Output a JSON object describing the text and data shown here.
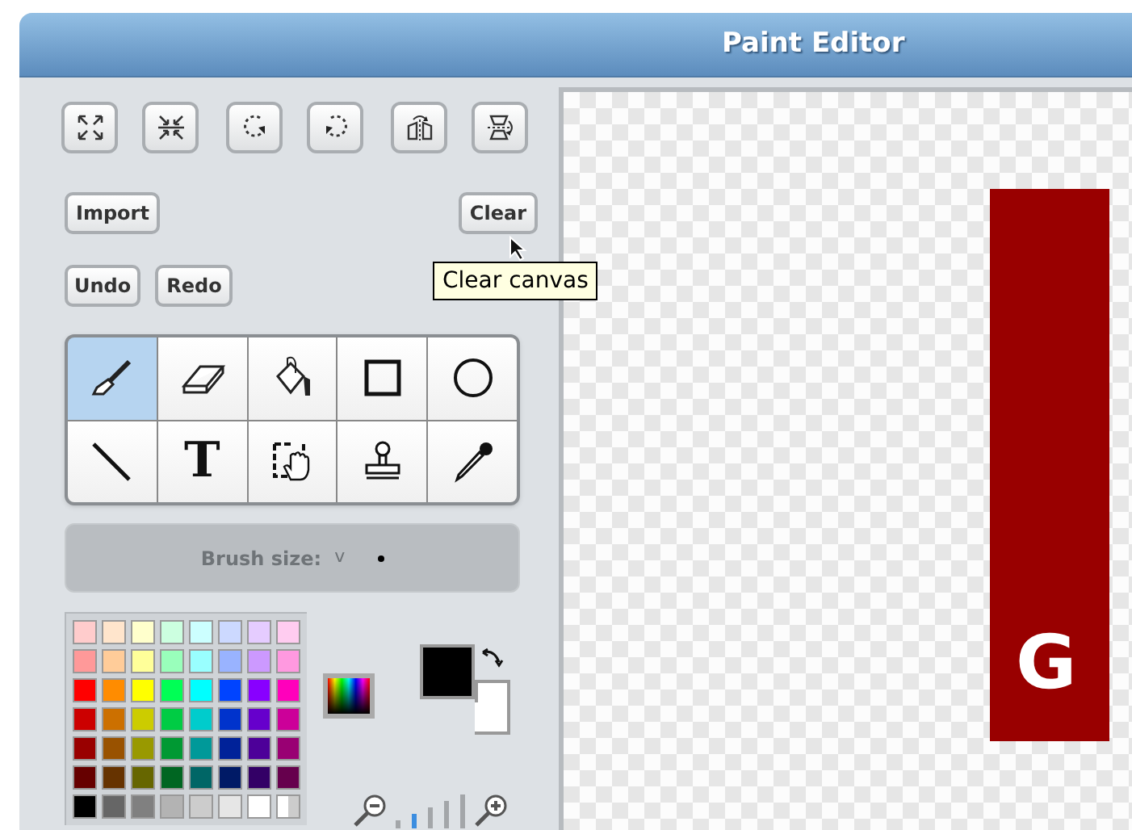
{
  "window": {
    "title": "Paint Editor"
  },
  "transform_buttons": [
    {
      "kind": "grow"
    },
    {
      "kind": "shrink"
    },
    {
      "kind": "rotate-left"
    },
    {
      "kind": "rotate-right"
    },
    {
      "kind": "flip-horizontal"
    },
    {
      "kind": "flip-vertical"
    }
  ],
  "buttons": {
    "import": "Import",
    "clear": "Clear",
    "undo": "Undo",
    "redo": "Redo"
  },
  "tooltip": "Clear canvas",
  "tools": [
    {
      "kind": "brush",
      "selected": true
    },
    {
      "kind": "eraser",
      "selected": false
    },
    {
      "kind": "fill",
      "selected": false
    },
    {
      "kind": "rectangle",
      "selected": false
    },
    {
      "kind": "ellipse",
      "selected": false
    },
    {
      "kind": "line",
      "selected": false
    },
    {
      "kind": "text",
      "label": "T",
      "selected": false
    },
    {
      "kind": "select",
      "selected": false
    },
    {
      "kind": "stamp",
      "selected": false
    },
    {
      "kind": "eyedropper",
      "selected": false
    }
  ],
  "brush_size": {
    "label": "Brush size:",
    "caret": "v"
  },
  "palette": [
    {
      "color": "#ffcccc"
    },
    {
      "color": "#ffe5cc"
    },
    {
      "color": "#ffffcc"
    },
    {
      "color": "#ccffe0"
    },
    {
      "color": "#ccffff"
    },
    {
      "color": "#ccd9ff"
    },
    {
      "color": "#e5ccff"
    },
    {
      "color": "#ffccf0"
    },
    {
      "color": "#ff9999"
    },
    {
      "color": "#ffcc99"
    },
    {
      "color": "#ffff99"
    },
    {
      "color": "#99ffbb"
    },
    {
      "color": "#99ffff"
    },
    {
      "color": "#99b3ff"
    },
    {
      "color": "#cc99ff"
    },
    {
      "color": "#ff99e0"
    },
    {
      "color": "#ff0000"
    },
    {
      "color": "#ff8c00"
    },
    {
      "color": "#ffff00"
    },
    {
      "color": "#00ff55"
    },
    {
      "color": "#00ffff"
    },
    {
      "color": "#0044ff"
    },
    {
      "color": "#8800ff"
    },
    {
      "color": "#ff00bb"
    },
    {
      "color": "#cc0000"
    },
    {
      "color": "#cc7000"
    },
    {
      "color": "#cccc00"
    },
    {
      "color": "#00cc44"
    },
    {
      "color": "#00cccc"
    },
    {
      "color": "#0033cc"
    },
    {
      "color": "#6600cc"
    },
    {
      "color": "#cc0099"
    },
    {
      "color": "#990000"
    },
    {
      "color": "#995200"
    },
    {
      "color": "#999900"
    },
    {
      "color": "#009933"
    },
    {
      "color": "#009999"
    },
    {
      "color": "#002299"
    },
    {
      "color": "#4d0099"
    },
    {
      "color": "#990073"
    },
    {
      "color": "#660000"
    },
    {
      "color": "#663300"
    },
    {
      "color": "#666600"
    },
    {
      "color": "#006622"
    },
    {
      "color": "#006666"
    },
    {
      "color": "#001a66"
    },
    {
      "color": "#330066"
    },
    {
      "color": "#66004d"
    },
    {
      "color": "#000000"
    },
    {
      "color": "#666666"
    },
    {
      "color": "#808080"
    },
    {
      "color": "#b3b3b3"
    },
    {
      "color": "#cccccc"
    },
    {
      "color": "#e6e6e6"
    },
    {
      "color": "#ffffff"
    }
  ],
  "zoom_steps": [
    {
      "selected": false
    },
    {
      "selected": true
    },
    {
      "selected": false
    },
    {
      "selected": false
    },
    {
      "selected": false
    }
  ],
  "canvas": {
    "text": "G"
  }
}
